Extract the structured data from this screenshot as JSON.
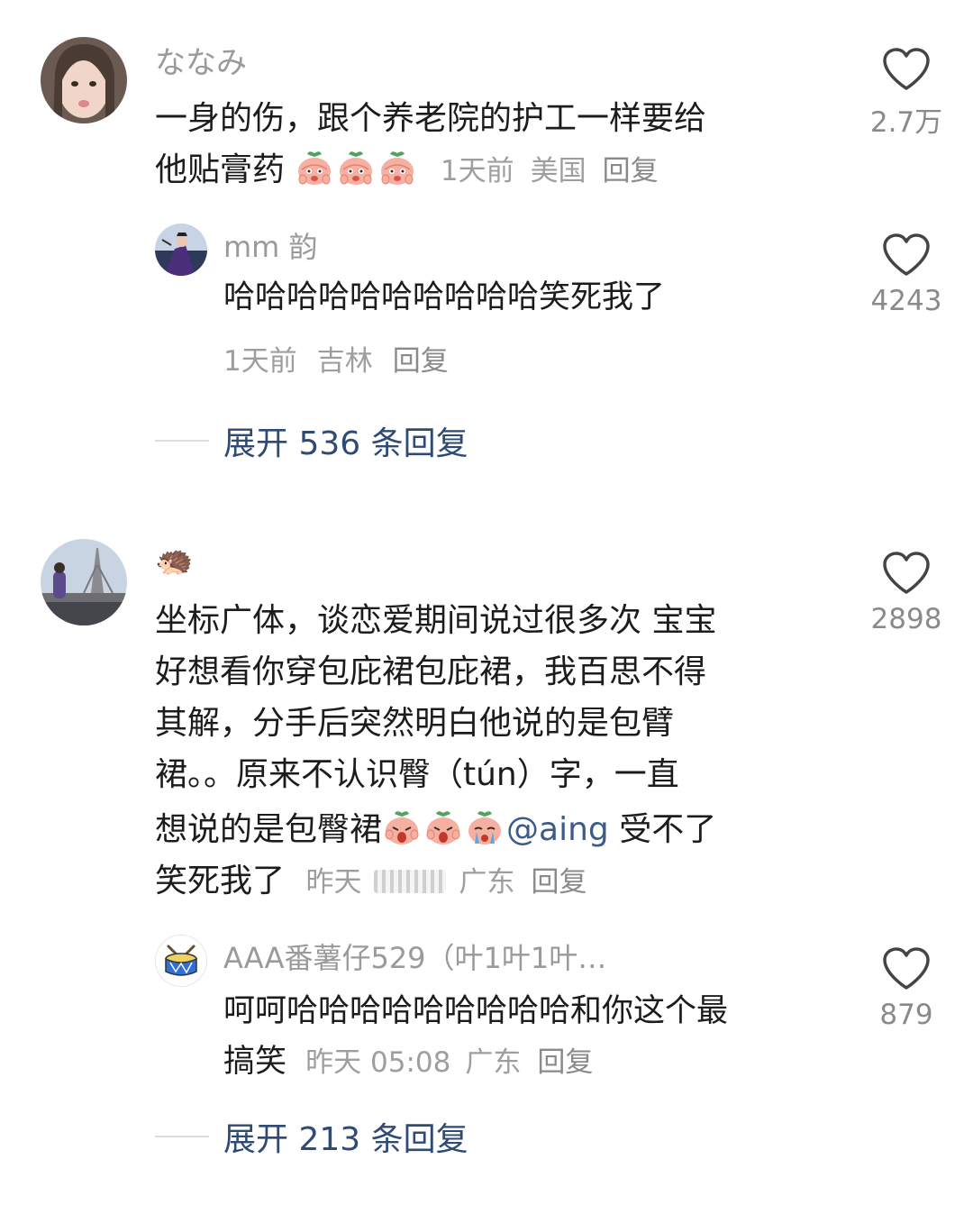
{
  "comments": [
    {
      "username": "ななみ",
      "text_line1": "一身的伤，跟个养老院的护工一样要给",
      "text_line2": "他贴膏药",
      "time": "1天前",
      "location": "美国",
      "reply_label": "回复",
      "likes": "2.7万",
      "reply": {
        "username": "mm 韵",
        "text": "哈哈哈哈哈哈哈哈哈哈笑死我了",
        "time": "1天前",
        "location": "吉林",
        "reply_label": "回复",
        "likes": "4243"
      },
      "expand_label": "展开 536 条回复"
    },
    {
      "username": "🦔",
      "text_lines": [
        "坐标广体，谈恋爱期间说过很多次 宝宝",
        "好想看你穿包庇裙包庇裙，我百思不得",
        "其解，分手后突然明白他说的是包臂",
        "裙。。原来不认识臀（tún）字，一直"
      ],
      "text_line5": "想说的是包臀裙",
      "mention": "@aing",
      "text_after_mention": " 受不了",
      "text_line6": "笑死我了",
      "time": "昨天",
      "location": "广东",
      "reply_label": "回复",
      "likes": "2898",
      "reply": {
        "username": "AAA番薯仔529（叶1叶1叶…",
        "text_line1": "呵呵哈哈哈哈哈哈哈哈哈和你这个最",
        "text_line2": "搞笑",
        "time": "昨天 05:08",
        "location": "广东",
        "reply_label": "回复",
        "likes": "879"
      },
      "expand_label": "展开 213 条回复"
    }
  ],
  "colors": {
    "username": "#9a9a9a",
    "text": "#1c1c1c",
    "meta": "#9e9e9e",
    "expand": "#2e4a75",
    "mention": "#3b5b8c"
  },
  "icons": {
    "like": "heart-outline-icon",
    "emoji": "peach-face-emoji"
  }
}
